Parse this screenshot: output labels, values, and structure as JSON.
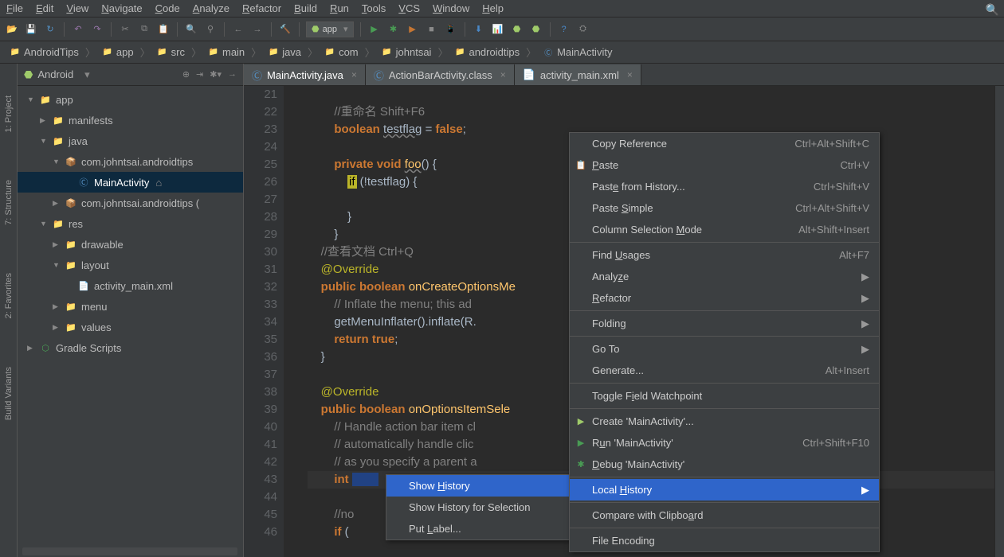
{
  "menu": [
    "File",
    "Edit",
    "View",
    "Navigate",
    "Code",
    "Analyze",
    "Refactor",
    "Build",
    "Run",
    "Tools",
    "VCS",
    "Window",
    "Help"
  ],
  "runConfig": "app",
  "breadcrumbs": [
    {
      "icon": "📁",
      "label": "AndroidTips",
      "cls": "color-folder"
    },
    {
      "icon": "📁",
      "label": "app",
      "cls": "color-folder"
    },
    {
      "icon": "📁",
      "label": "src",
      "cls": "color-folder"
    },
    {
      "icon": "📁",
      "label": "main",
      "cls": "color-folder"
    },
    {
      "icon": "📁",
      "label": "java",
      "cls": "color-java"
    },
    {
      "icon": "📁",
      "label": "com",
      "cls": "color-folder"
    },
    {
      "icon": "📁",
      "label": "johntsai",
      "cls": "color-folder"
    },
    {
      "icon": "📁",
      "label": "androidtips",
      "cls": "color-folder"
    },
    {
      "icon": "Ⓒ",
      "label": "MainActivity",
      "cls": "color-class"
    }
  ],
  "leftrail": [
    "1: Project",
    "7: Structure",
    "2: Favorites",
    "Build Variants"
  ],
  "sidebar": {
    "viewTitle": "Android",
    "tree": [
      {
        "indent": 12,
        "arrow": "▼",
        "ico": "📁",
        "label": "app",
        "cls": "color-folder bold"
      },
      {
        "indent": 28,
        "arrow": "▶",
        "ico": "📁",
        "label": "manifests",
        "cls": "color-java"
      },
      {
        "indent": 28,
        "arrow": "▼",
        "ico": "📁",
        "label": "java",
        "cls": "color-java"
      },
      {
        "indent": 44,
        "arrow": "▼",
        "ico": "📦",
        "label": "com.johntsai.androidtips",
        "cls": "color-folder"
      },
      {
        "indent": 60,
        "arrow": "",
        "ico": "Ⓒ",
        "label": "MainActivity",
        "cls": "color-class",
        "selected": true,
        "extra": "⌂"
      },
      {
        "indent": 44,
        "arrow": "▶",
        "ico": "📦",
        "label": "com.johntsai.androidtips (",
        "cls": "color-folder"
      },
      {
        "indent": 28,
        "arrow": "▼",
        "ico": "📁",
        "label": "res",
        "cls": "color-folder"
      },
      {
        "indent": 44,
        "arrow": "▶",
        "ico": "📁",
        "label": "drawable",
        "cls": "color-folder"
      },
      {
        "indent": 44,
        "arrow": "▼",
        "ico": "📁",
        "label": "layout",
        "cls": "color-folder"
      },
      {
        "indent": 60,
        "arrow": "",
        "ico": "📄",
        "label": "activity_main.xml",
        "cls": "color-xml"
      },
      {
        "indent": 44,
        "arrow": "▶",
        "ico": "📁",
        "label": "menu",
        "cls": "color-folder"
      },
      {
        "indent": 44,
        "arrow": "▶",
        "ico": "📁",
        "label": "values",
        "cls": "color-folder"
      },
      {
        "indent": 12,
        "arrow": "▶",
        "ico": "⬡",
        "label": "Gradle Scripts",
        "cls": "gradle-ico"
      }
    ]
  },
  "tabs": [
    {
      "icon": "Ⓒ",
      "label": "MainActivity.java",
      "cls": "color-class",
      "active": true
    },
    {
      "icon": "Ⓒ",
      "label": "ActionBarActivity.class",
      "cls": "color-class"
    },
    {
      "icon": "📄",
      "label": "activity_main.xml",
      "cls": "color-xml"
    }
  ],
  "code": {
    "start": 21,
    "lines": [
      "",
      "        <span class='cm'>//重命名 Shift+F6</span>",
      "        <span class='kw'>boolean</span> <span class='ul'>testflag</span> = <span class='bl'>false</span>;",
      "",
      "        <span class='kw'>private void</span> <span class='fn ul'>foo</span>() {",
      "            <span class='ifhl'>if</span> (!testflag) {",
      "",
      "            }",
      "        }",
      "    <span class='cm'>//查看文档 Ctrl+Q</span>",
      "    <span class='an'>@Override</span>",
      "    <span class='kw'>public boolean</span> <span class='fn'>onCreateOptionsMe</span>",
      "        <span class='cm'>// Inflate the menu; this ad</span>",
      "        getMenuInflater().inflate(R.",
      "        <span class='kw'>return true</span>;",
      "    }",
      "",
      "    <span class='an'>@Override</span>",
      "    <span class='kw'>public boolean</span> <span class='fn'>onOptionsItemSele</span>",
      "        <span class='cm'>// Handle action bar item cl</span>",
      "        <span class='cm'>// automatically handle clic</span>",
      "        <span class='cm'>// as you specify a parent a</span>",
      "        <span class='kw'>int</span> <span class='sel'>        </span>",
      "",
      "        <span class='cm'>//no</span>",
      "        <span class='kw'>if</span> ("
    ]
  },
  "contextMenu": {
    "groups": [
      [
        {
          "label": "Copy Reference",
          "sc": "Ctrl+Alt+Shift+C"
        },
        {
          "label": "Paste",
          "sc": "Ctrl+V",
          "ul": 0,
          "ico": "📋"
        },
        {
          "label": "Paste from History...",
          "sc": "Ctrl+Shift+V",
          "ul": 4
        },
        {
          "label": "Paste Simple",
          "sc": "Ctrl+Alt+Shift+V",
          "ul": 6
        },
        {
          "label": "Column Selection Mode",
          "sc": "Alt+Shift+Insert",
          "ul": 17
        }
      ],
      [
        {
          "label": "Find Usages",
          "sc": "Alt+F7",
          "ul": 5
        },
        {
          "label": "Analyze",
          "arr": true,
          "ul": 5
        },
        {
          "label": "Refactor",
          "arr": true,
          "ul": 0
        }
      ],
      [
        {
          "label": "Folding",
          "arr": true,
          "ul": 6
        }
      ],
      [
        {
          "label": "Go To",
          "arr": true
        },
        {
          "label": "Generate...",
          "sc": "Alt+Insert"
        }
      ],
      [
        {
          "label": "Toggle Field Watchpoint",
          "ul": 8
        }
      ],
      [
        {
          "label": "Create 'MainActivity'...",
          "ico": "▶",
          "icoCls": "android-ico"
        },
        {
          "label": "Run 'MainActivity'",
          "sc": "Ctrl+Shift+F10",
          "ul": 1,
          "ico": "▶",
          "icoCls": "run-tri"
        },
        {
          "label": "Debug 'MainActivity'",
          "ul": 0,
          "ico": "✱",
          "icoCls": "color-bug"
        }
      ],
      [
        {
          "label": "Local History",
          "arr": true,
          "ul": 6,
          "hover": true
        }
      ],
      [
        {
          "label": "Compare with Clipboard",
          "ul": 19
        }
      ],
      [
        {
          "label": "File Encoding"
        }
      ]
    ]
  },
  "subMenu": [
    {
      "label": "Show History",
      "ul": 5,
      "hover": true
    },
    {
      "label": "Show History for Selection"
    },
    {
      "label": "Put Label...",
      "ul": 4
    }
  ]
}
